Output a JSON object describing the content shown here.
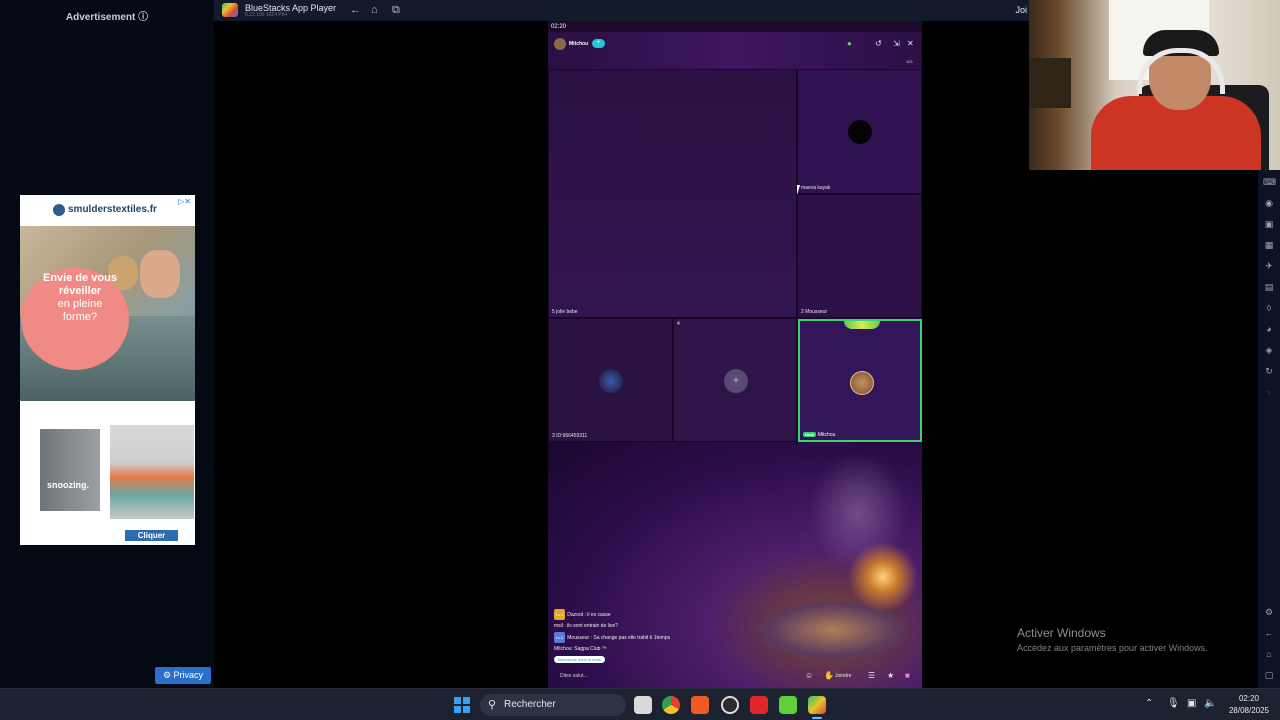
{
  "ad": {
    "header": "Advertisement ⓘ",
    "brand": "smulderstextiles.fr",
    "choices": "▷✕",
    "bubble_line1": "Envie de vous",
    "bubble_line2": "réveiller",
    "bubble_line3": "en pleine",
    "bubble_line4": "forme?",
    "product_label": "snoozing.",
    "cta": "Cliquer",
    "privacy": "⚙ Privacy"
  },
  "bluestacks": {
    "title": "BlueStacks App Player",
    "version": "5.22.100.1024 P64",
    "join": "Joi"
  },
  "phone": {
    "time": "02:20",
    "host_name": "Mitchou",
    "tiles": [
      {
        "label": "5  jolie bebe"
      },
      {
        "label": "maeva kayak"
      },
      {
        "label": "2  Mousseur"
      },
      {
        "label": "3  ID:966459311"
      },
      {
        "label": "4"
      },
      {
        "label": "Mitchou",
        "tag": "Host"
      }
    ],
    "online_count": "421",
    "chat": [
      {
        "badge": "Lv.1",
        "text": "Dazoot : il es casse"
      },
      {
        "text": "msil : ils sont entrain de live?"
      },
      {
        "badge2": "Lv.2",
        "text": "Mousseur : Sa change pas elle trahit ti 1temps"
      },
      {
        "text": "Mitchou: Sagpa Club ™"
      },
      {
        "pill": "Bienvenue dans la room"
      }
    ],
    "say_hi": "Dites salut...",
    "join": "Joindre"
  },
  "watermark": {
    "title": "Activer Windows",
    "subtitle": "Accédez aux paramètres pour activer Windows."
  },
  "taskbar": {
    "search": "Rechercher",
    "time": "02:20",
    "date": "28/08/2025"
  }
}
